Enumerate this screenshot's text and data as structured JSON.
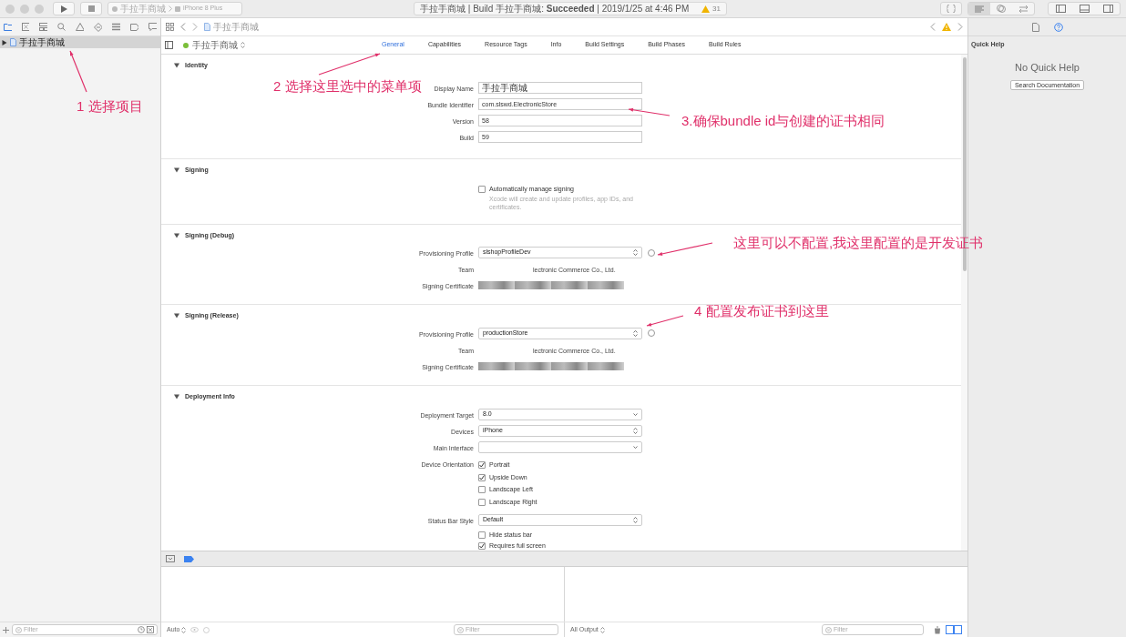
{
  "toolbar": {
    "scheme": "手拉手商城",
    "device": "iPhone 8 Plus",
    "activity": "手拉手商城 | Build 手拉手商城: **Succeeded** | 2019/1/25 at 4:46 PM",
    "warning_count": "31"
  },
  "navigator": {
    "items": [
      {
        "label": "手拉手商城",
        "selected": true,
        "expanded": false
      }
    ],
    "filter": {
      "placeholder": "Filter"
    }
  },
  "editor": {
    "breadcrumb": "手拉手商城",
    "target": "手拉手商城",
    "tabs": [
      {
        "label": "General",
        "selected": true
      },
      {
        "label": "Capabilities",
        "selected": false
      },
      {
        "label": "Resource Tags",
        "selected": false
      },
      {
        "label": "Info",
        "selected": false
      },
      {
        "label": "Build Settings",
        "selected": false
      },
      {
        "label": "Build Phases",
        "selected": false
      },
      {
        "label": "Build Rules",
        "selected": false
      }
    ],
    "sections": [
      {
        "title": "Identity",
        "expanded": true,
        "rows": [
          {
            "kind": "text",
            "label": "Display Name",
            "value": "手拉手商城"
          },
          {
            "kind": "text",
            "label": "Bundle Identifier",
            "value": "com.slswd.ElectronicStore"
          },
          {
            "kind": "text",
            "label": "Version",
            "value": "58"
          },
          {
            "kind": "text",
            "label": "Build",
            "value": "59"
          }
        ]
      },
      {
        "title": "Signing",
        "expanded": true,
        "rows": [
          {
            "kind": "checkbox",
            "label": "Automatically manage signing",
            "checked": false,
            "note": "Xcode will create and update profiles, app IDs, and certificates."
          }
        ]
      },
      {
        "title": "Signing (Debug)",
        "expanded": true,
        "rows": [
          {
            "kind": "popup",
            "label": "Provisioning Profile",
            "value": "slshopProfileDev",
            "info": true
          },
          {
            "kind": "static",
            "label": "Team",
            "value": "lectronic Commerce Co., Ltd."
          },
          {
            "kind": "redacted",
            "label": "Signing Certificate"
          }
        ]
      },
      {
        "title": "Signing (Release)",
        "expanded": true,
        "rows": [
          {
            "kind": "popup",
            "label": "Provisioning Profile",
            "value": "productionStore",
            "info": true
          },
          {
            "kind": "static",
            "label": "Team",
            "value": "lectronic Commerce Co., Ltd."
          },
          {
            "kind": "redacted",
            "label": "Signing Certificate"
          }
        ]
      },
      {
        "title": "Deployment Info",
        "expanded": true,
        "rows": [
          {
            "kind": "combo",
            "label": "Deployment Target",
            "value": "8.0"
          },
          {
            "kind": "popup",
            "label": "Devices",
            "value": "iPhone"
          },
          {
            "kind": "combo",
            "label": "Main Interface"
          },
          {
            "kind": "checklist",
            "label": "Device Orientation",
            "options": [
              {
                "label": "Portrait",
                "checked": true
              },
              {
                "label": "Upside Down",
                "checked": true
              },
              {
                "label": "Landscape Left",
                "checked": false
              },
              {
                "label": "Landscape Right",
                "checked": false
              }
            ]
          },
          {
            "kind": "popup",
            "label": "Status Bar Style",
            "value": "Default"
          },
          {
            "kind": "checkbox",
            "label": "Hide status bar",
            "checked": false
          },
          {
            "kind": "checkbox",
            "label": "Requires full screen",
            "checked": true
          }
        ]
      }
    ]
  },
  "debug_area": {
    "variables_scope": "Auto",
    "variables_filter": {
      "placeholder": "Filter"
    },
    "console_scope": "All Output",
    "console_filter": {
      "placeholder": "Filter"
    }
  },
  "inspector": {
    "title": "Quick Help",
    "message": "No Quick Help",
    "button": "Search Documentation"
  },
  "annotations": [
    {
      "text": "1 选择项目"
    },
    {
      "text": "2 选择这里选中的菜单项"
    },
    {
      "text": "3.确保bundle id与创建的证书相同"
    },
    {
      "text": "这里可以不配置,我这里配置的是开发证书"
    },
    {
      "text": "4 配置发布证书到这里"
    }
  ]
}
